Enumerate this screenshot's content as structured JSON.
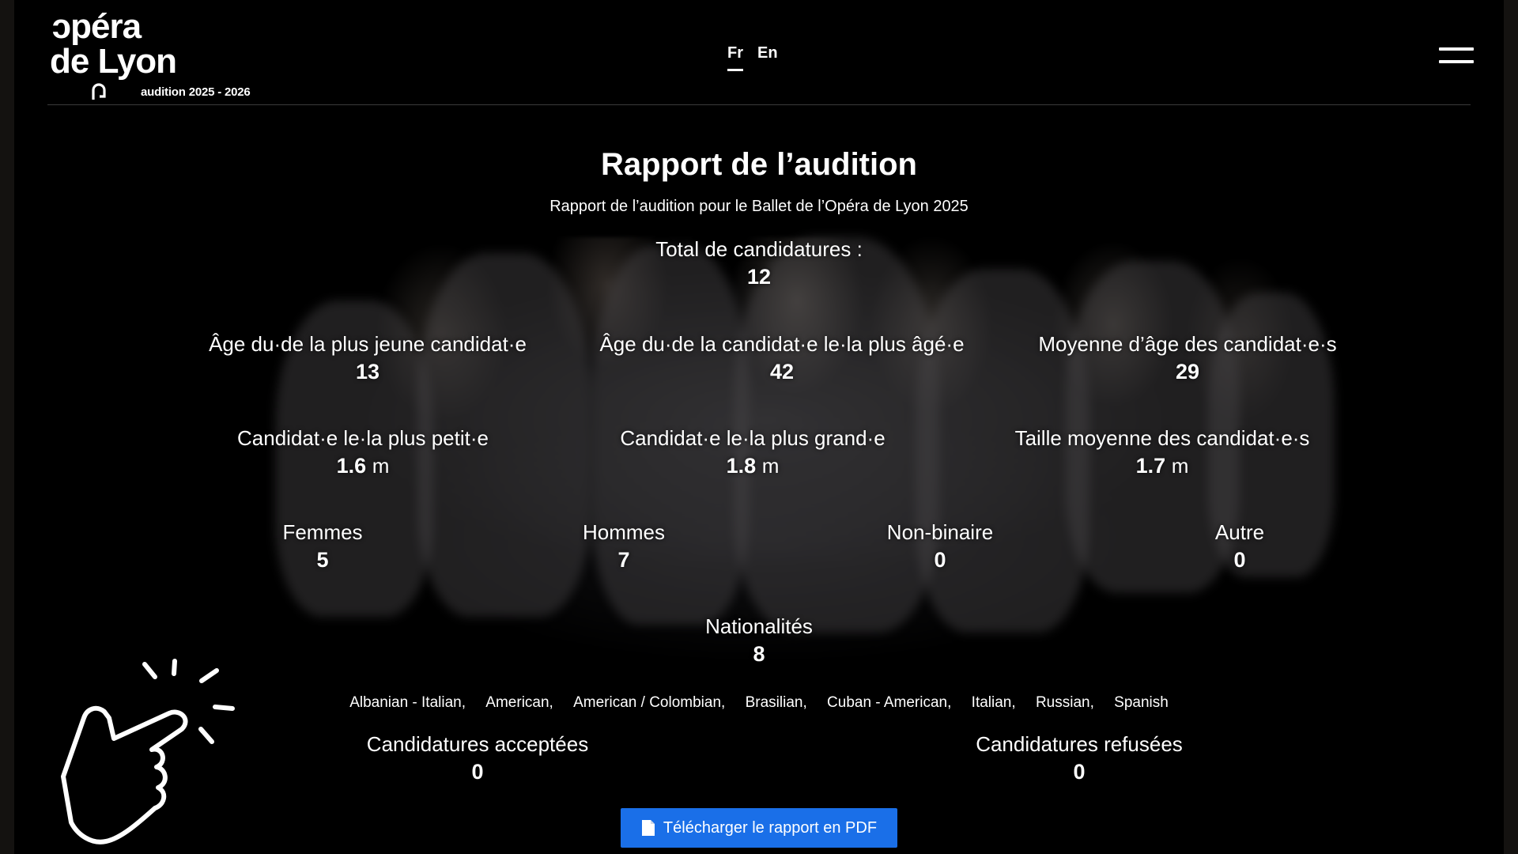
{
  "header": {
    "logo_line1": " ɔpéra",
    "logo_line2": "de Lyon",
    "logo_sub": "audition 2025 - 2026",
    "languages": [
      {
        "label": "Fr",
        "active": true
      },
      {
        "label": "En",
        "active": false
      }
    ],
    "menu_icon": "hamburger-icon"
  },
  "report": {
    "title": "Rapport de l’audition",
    "subtitle": "Rapport de l’audition pour le Ballet de l’Opéra de Lyon 2025",
    "total": {
      "label": "Total de candidatures :",
      "value": "12"
    },
    "ages": [
      {
        "label": "Âge du·de la plus jeune candidat·e",
        "value": "13"
      },
      {
        "label": "Âge du·de la candidat·e le·la plus âgé·e",
        "value": "42"
      },
      {
        "label": "Moyenne d’âge des candidat·e·s",
        "value": "29"
      }
    ],
    "heights": [
      {
        "label": "Candidat·e le·la plus petit·e",
        "value": "1.6",
        "unit": "m"
      },
      {
        "label": "Candidat·e le·la plus grand·e",
        "value": "1.8",
        "unit": "m"
      },
      {
        "label": "Taille moyenne des candidat·e·s",
        "value": "1.7",
        "unit": "m"
      }
    ],
    "genders": [
      {
        "label": "Femmes",
        "value": "5"
      },
      {
        "label": "Hommes",
        "value": "7"
      },
      {
        "label": "Non-binaire",
        "value": "0"
      },
      {
        "label": "Autre",
        "value": "0"
      }
    ],
    "nationalities": {
      "label": "Nationalités",
      "value": "8",
      "list": [
        "Albanian - Italian,",
        "American,",
        "American / Colombian,",
        "Brasilian,",
        "Cuban - American,",
        "Italian,",
        "Russian,",
        "Spanish"
      ]
    },
    "accepted": {
      "label": "Candidatures acceptées",
      "value": "0"
    },
    "refused": {
      "label": "Candidatures refusées",
      "value": "0"
    },
    "pdf_button": {
      "label": "Télécharger le rapport en PDF",
      "icon": "document-icon"
    }
  },
  "overlay": {
    "icon": "pointing-hand-icon"
  },
  "colors": {
    "background": "#000000",
    "text": "#ffffff",
    "button": "#1a6fe8",
    "rule": "#3a3a3a"
  }
}
